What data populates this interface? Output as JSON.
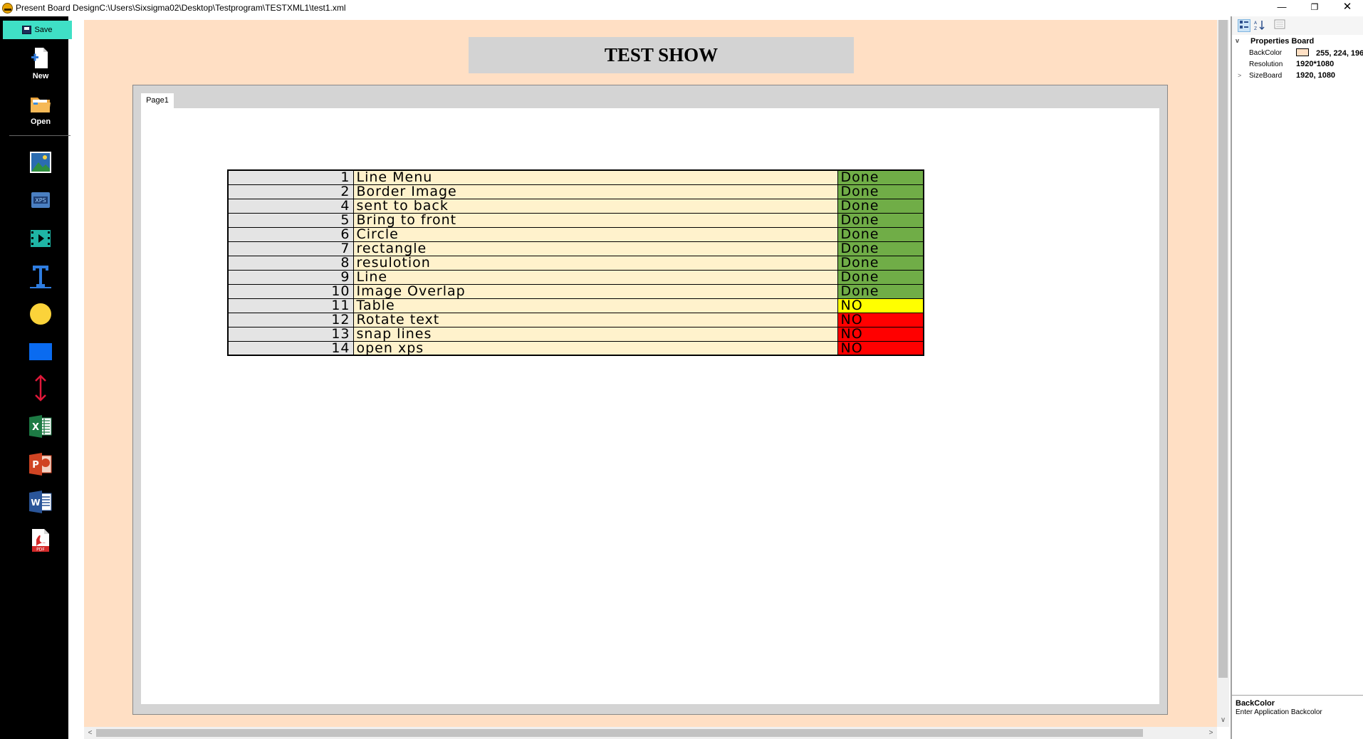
{
  "window": {
    "title": "Present Board DesignC:\\Users\\Sixsigma02\\Desktop\\Testprogram\\TESTXML1\\test1.xml",
    "minimize_glyph": "—",
    "maximize_glyph": "❐",
    "close_glyph": "✕"
  },
  "toolbar": {
    "save_label": "Save",
    "new_label": "New",
    "open_label": "Open",
    "tools": [
      "image-icon",
      "xps-icon",
      "video-icon",
      "text-icon",
      "circle-icon",
      "rectangle-icon",
      "line-icon",
      "excel-icon",
      "powerpoint-icon",
      "word-icon",
      "pdf-icon"
    ],
    "xps_text": "XPS",
    "excel_letter": "X",
    "powerpoint_letter": "P",
    "word_letter": "W",
    "pdf_text": "PDF"
  },
  "board": {
    "title": "TEST SHOW",
    "background_color": "#FFDFC4",
    "page_tab": "Page1"
  },
  "status_table": {
    "rows": [
      {
        "num": "1",
        "feature": "Line Menu",
        "status": "Done",
        "status_color": "#70AD47"
      },
      {
        "num": "2",
        "feature": "Border Image",
        "status": "Done",
        "status_color": "#70AD47"
      },
      {
        "num": "4",
        "feature": "sent to back",
        "status": "Done",
        "status_color": "#70AD47"
      },
      {
        "num": "5",
        "feature": "Bring to front",
        "status": "Done",
        "status_color": "#70AD47"
      },
      {
        "num": "6",
        "feature": "Circle",
        "status": "Done",
        "status_color": "#70AD47"
      },
      {
        "num": "7",
        "feature": "rectangle",
        "status": "Done",
        "status_color": "#70AD47"
      },
      {
        "num": "8",
        "feature": "resulotion",
        "status": "Done",
        "status_color": "#70AD47"
      },
      {
        "num": "9",
        "feature": "Line",
        "status": "Done",
        "status_color": "#70AD47"
      },
      {
        "num": "10",
        "feature": "Image Overlap",
        "status": "Done",
        "status_color": "#70AD47"
      },
      {
        "num": "11",
        "feature": "Table",
        "status": "NO",
        "status_color": "#FFFF00"
      },
      {
        "num": "12",
        "feature": "Rotate text",
        "status": "NO",
        "status_color": "#FF0000"
      },
      {
        "num": "13",
        "feature": "snap lines",
        "status": "NO",
        "status_color": "#FF0000"
      },
      {
        "num": "14",
        "feature": "open xps",
        "status": "NO",
        "status_color": "#FF0000"
      }
    ]
  },
  "properties": {
    "category": "Properties Board",
    "category_expander": "v",
    "items": [
      {
        "name": "BackColor",
        "value": "255, 224, 196",
        "swatch": "#FFE0C4",
        "expander": ""
      },
      {
        "name": "Resolution",
        "value": "1920*1080",
        "expander": ""
      },
      {
        "name": "SizeBoard",
        "value": "1920, 1080",
        "expander": ">"
      }
    ],
    "help_title": "BackColor",
    "help_description": "Enter Application Backcolor"
  },
  "scrollbars": {
    "down_glyph": "∨",
    "left_glyph": "<",
    "right_glyph": ">"
  }
}
